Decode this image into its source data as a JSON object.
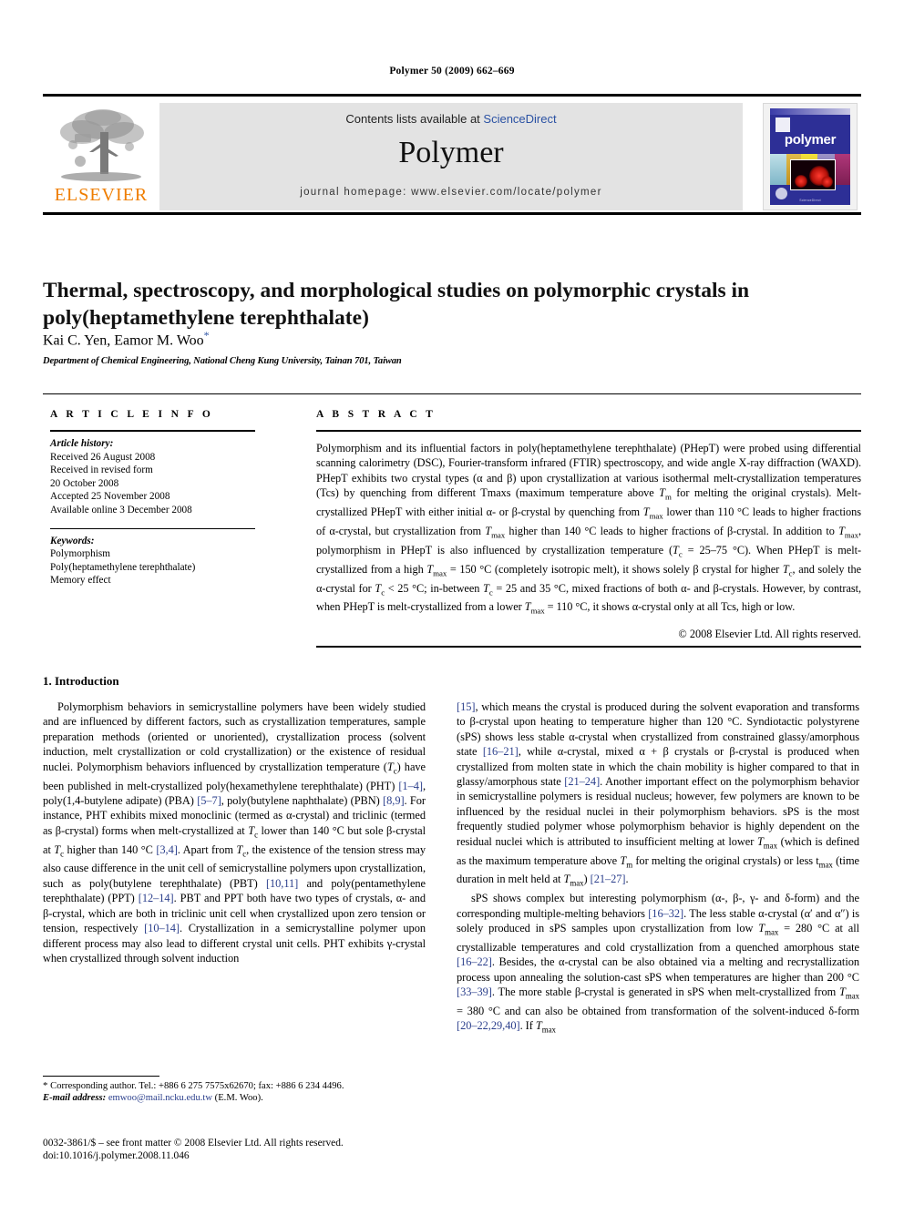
{
  "running_head": "Polymer 50 (2009) 662–669",
  "masthead": {
    "publisher_logo_text": "ELSEVIER",
    "contents_prefix": "Contents lists available at ",
    "contents_link": "ScienceDirect",
    "journal_name": "Polymer",
    "homepage": "journal homepage: www.elsevier.com/locate/polymer",
    "cover_title": "polymer",
    "cover_caption": "ScienceDirect",
    "link_color": "#2a51a3",
    "logo_color": "#ef7d00",
    "cover_bg_color": "#2d2f96"
  },
  "article": {
    "title": "Thermal, spectroscopy, and morphological studies on polymorphic crystals in poly(heptamethylene terephthalate)",
    "authors": "Kai C. Yen, Eamor M. Woo",
    "author_star": "*",
    "affiliation": "Department of Chemical Engineering, National Cheng Kung University, Tainan 701, Taiwan"
  },
  "article_info": {
    "label": "A R T I C L E   I N F O",
    "history_heading": "Article history:",
    "history": [
      "Received 26 August 2008",
      "Received in revised form",
      "20 October 2008",
      "Accepted 25 November 2008",
      "Available online 3 December 2008"
    ],
    "keywords_heading": "Keywords:",
    "keywords": [
      "Polymorphism",
      "Poly(heptamethylene terephthalate)",
      "Memory effect"
    ]
  },
  "abstract": {
    "label": "A B S T R A C T",
    "text_parts": {
      "p1": "Polymorphism and its influential factors in poly(heptamethylene terephthalate) (PHepT) were probed using differential scanning calorimetry (DSC), Fourier-transform infrared (FTIR) spectroscopy, and wide angle X-ray diffraction (WAXD). PHepT exhibits two crystal types (α and β) upon crystallization at various isothermal melt-crystallization temperatures (Tcs) by quenching from different Tmaxs (maximum temperature above Tm for melting the original crystals). Melt-crystallized PHepT with either initial α- or β-crystal by quenching from Tmax lower than 110 °C leads to higher fractions of α-crystal, but crystallization from Tmax higher than 140 °C leads to higher fractions of β-crystal. In addition to Tmax, polymorphism in PHepT is also influenced by crystallization temperature (Tc = 25–75 °C). When PHepT is melt-crystallized from a high Tmax = 150 °C (completely isotropic melt), it shows solely β crystal for higher Tc, and solely the α-crystal for Tc < 25 °C; in-between Tc = 25 and 35 °C, mixed fractions of both α- and β-crystals. However, by contrast, when PHepT is melt-crystallized from a lower Tmax = 110 °C, it shows α-crystal only at all Tcs, high or low."
    },
    "copyright": "© 2008 Elsevier Ltd. All rights reserved."
  },
  "body": {
    "section_number": "1.",
    "section_title": "Introduction",
    "left_column": {
      "p1": "Polymorphism behaviors in semicrystalline polymers have been widely studied and are influenced by different factors, such as crystallization temperatures, sample preparation methods (oriented or unoriented), crystallization process (solvent induction, melt crystallization or cold crystallization) or the existence of residual nuclei. Polymorphism behaviors influenced by crystallization temperature (Tc) have been published in melt-crystallized poly(hexamethylene terephthalate) (PHT) [1–4], poly(1,4-butylene adipate) (PBA) [5–7], poly(butylene naphthalate) (PBN) [8,9]. For instance, PHT exhibits mixed monoclinic (termed as α-crystal) and triclinic (termed as β-crystal) forms when melt-crystallized at Tc lower than 140 °C but sole β-crystal at Tc higher than 140 °C [3,4]. Apart from Tc, the existence of the tension stress may also cause difference in the unit cell of semicrystalline polymers upon crystallization, such as poly(butylene terephthalate) (PBT) [10,11] and poly(pentamethylene terephthalate) (PPT) [12–14]. PBT and PPT both have two types of crystals, α- and β-crystal, which are both in triclinic unit cell when crystallized upon zero tension or tension, respectively [10–14]. Crystallization in a semicrystalline polymer upon different process may also lead to different crystal unit cells. PHT exhibits γ-crystal when crystallized through solvent induction"
    },
    "right_column": {
      "p1": "[15], which means the crystal is produced during the solvent evaporation and transforms to β-crystal upon heating to temperature higher than 120 °C. Syndiotactic polystyrene (sPS) shows less stable α-crystal when crystallized from constrained glassy/amorphous state [16–21], while α-crystal, mixed α + β crystals or β-crystal is produced when crystallized from molten state in which the chain mobility is higher compared to that in glassy/amorphous state [21–24]. Another important effect on the polymorphism behavior in semicrystalline polymers is residual nucleus; however, few polymers are known to be influenced by the residual nuclei in their polymorphism behaviors. sPS is the most frequently studied polymer whose polymorphism behavior is highly dependent on the residual nuclei which is attributed to insufficient melting at lower Tmax (which is defined as the maximum temperature above Tm for melting the original crystals) or less tmax (time duration in melt held at Tmax) [21–27].",
      "p2": "sPS shows complex but interesting polymorphism (α-, β-, γ- and δ-form) and the corresponding multiple-melting behaviors [16–32]. The less stable α-crystal (α′ and α″) is solely produced in sPS samples upon crystallization from low Tmax = 280 °C at all crystallizable temperatures and cold crystallization from a quenched amorphous state [16–22]. Besides, the α-crystal can be also obtained via a melting and recrystallization process upon annealing the solution-cast sPS when temperatures are higher than 200 °C [33–39]. The more stable β-crystal is generated in sPS when melt-crystallized from Tmax = 380 °C and can also be obtained from transformation of the solvent-induced δ-form [20–22,29,40]. If Tmax"
    }
  },
  "footnote": {
    "star": "*",
    "corresponding": "Corresponding author. Tel.: +886 6 275 7575x62670; fax: +886 6 234 4496.",
    "email_label": "E-mail address:",
    "email": "emwoo@mail.ncku.edu.tw",
    "email_owner": "(E.M. Woo)."
  },
  "imprint": {
    "line1": "0032-3861/$ – see front matter © 2008 Elsevier Ltd. All rights reserved.",
    "line2": "doi:10.1016/j.polymer.2008.11.046"
  }
}
